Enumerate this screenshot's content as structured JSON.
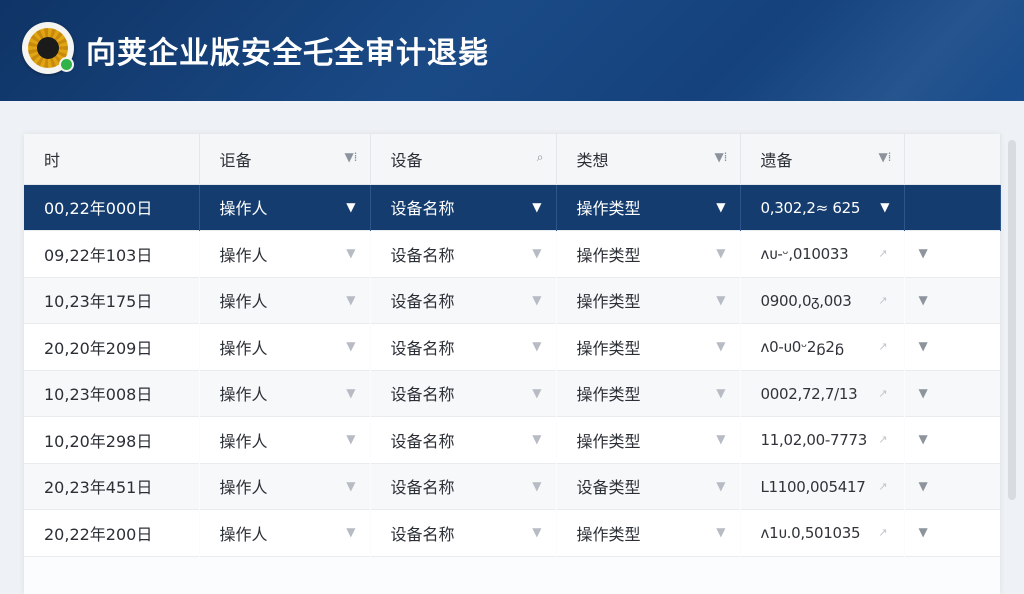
{
  "header": {
    "title": "向荚企业版安全乇全审计退毙"
  },
  "table": {
    "columns": [
      {
        "label": "时",
        "icon": ""
      },
      {
        "label": "讵备",
        "icon": "filter-icon"
      },
      {
        "label": "设备",
        "icon": "search-icon"
      },
      {
        "label": "类想",
        "icon": "filter-icon"
      },
      {
        "label": "遗备",
        "icon": "filter-icon"
      },
      {
        "label": "",
        "icon": ""
      }
    ],
    "rows": [
      {
        "time": "00,22年000日",
        "operator": "操作人",
        "device": "设备名称",
        "type": "操作类型",
        "detail": "0,302,2≈ 625",
        "selected": true
      },
      {
        "time": "09,22年103日",
        "operator": "操作人",
        "device": "设备名称",
        "type": "操作类型",
        "detail": "ᴧᴜ-ᵕ,010033",
        "selected": false
      },
      {
        "time": "10,23年175日",
        "operator": "操作人",
        "device": "设备名称",
        "type": "操作类型",
        "detail": "0900,0ᵹ,003",
        "selected": false
      },
      {
        "time": "20,20年209日",
        "operator": "操作人",
        "device": "设备名称",
        "type": "操作类型",
        "detail": "ᴧ0-ᴜ0ᵕ2ᵷ2ᵷ",
        "selected": false
      },
      {
        "time": "10,23年008日",
        "operator": "操作人",
        "device": "设备名称",
        "type": "操作类型",
        "detail": "0002,72,7/13",
        "selected": false
      },
      {
        "time": "10,20年298日",
        "operator": "操作人",
        "device": "设备名称",
        "type": "操作类型",
        "detail": "11,02,00-7773",
        "selected": false
      },
      {
        "time": "20,23年451日",
        "operator": "操作人",
        "device": "设备名称",
        "type": "设备类型",
        "detail": "L1100,005417",
        "selected": false
      },
      {
        "time": "20,22年200日",
        "operator": "操作人",
        "device": "设备名称",
        "type": "操作类型",
        "detail": "ᴧ1ᴜ.0,501035",
        "selected": false
      }
    ]
  }
}
